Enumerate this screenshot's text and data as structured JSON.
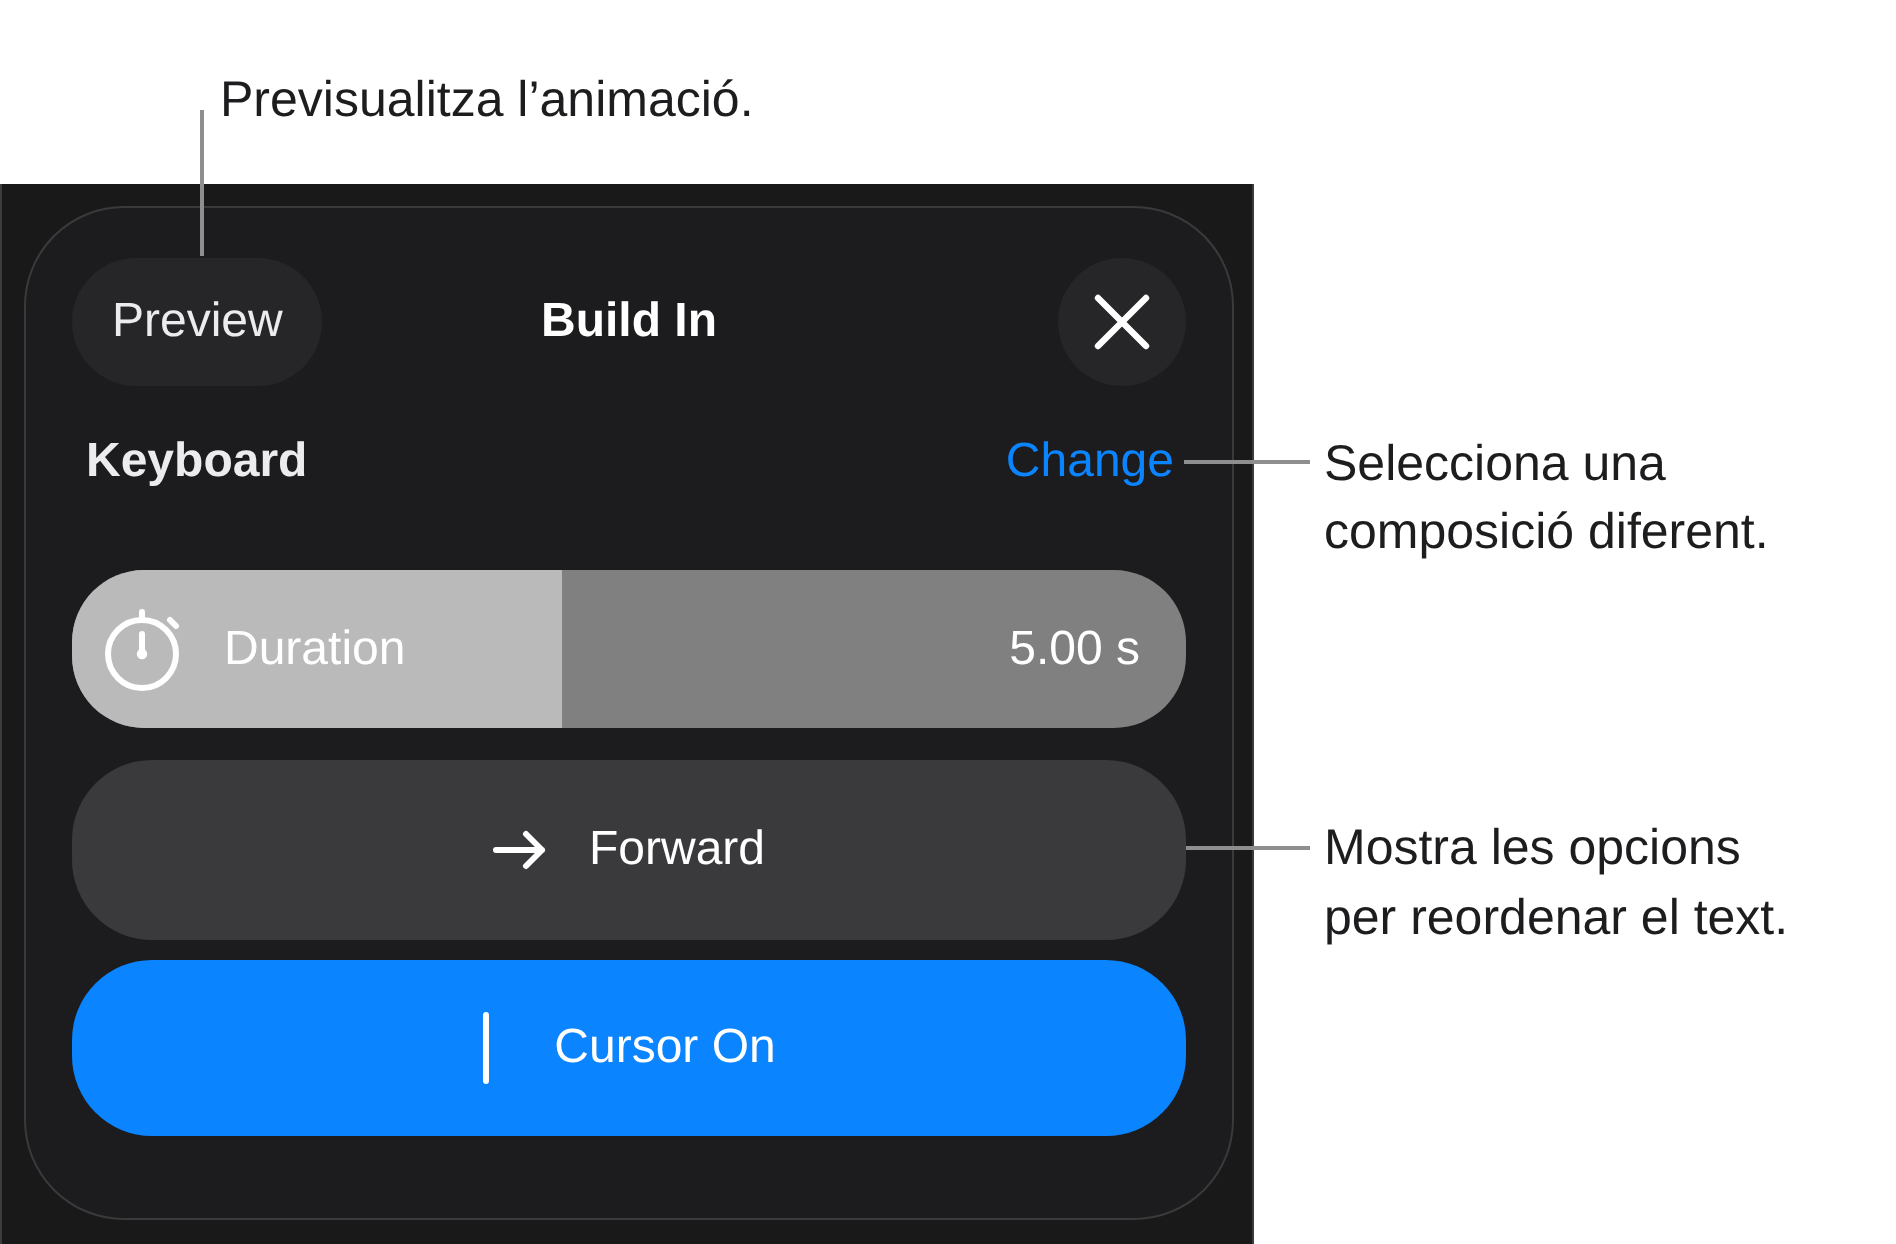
{
  "build_panel": {
    "preview_button": {
      "label": "Preview",
      "callout": "Previsualitza l’animació."
    },
    "title": "Build In",
    "effect": {
      "name": "Keyboard",
      "change_link": {
        "label": "Change",
        "callout": "Selecciona una composició diferent."
      }
    },
    "duration": {
      "label": "Duration",
      "level": 0.44,
      "reading": "5.00 s"
    },
    "direction_button": {
      "label": "Forward",
      "callout": "Mostra les opcions per reordenar el text."
    },
    "cursor_button": {
      "label": "Cursor On",
      "on": true
    }
  }
}
